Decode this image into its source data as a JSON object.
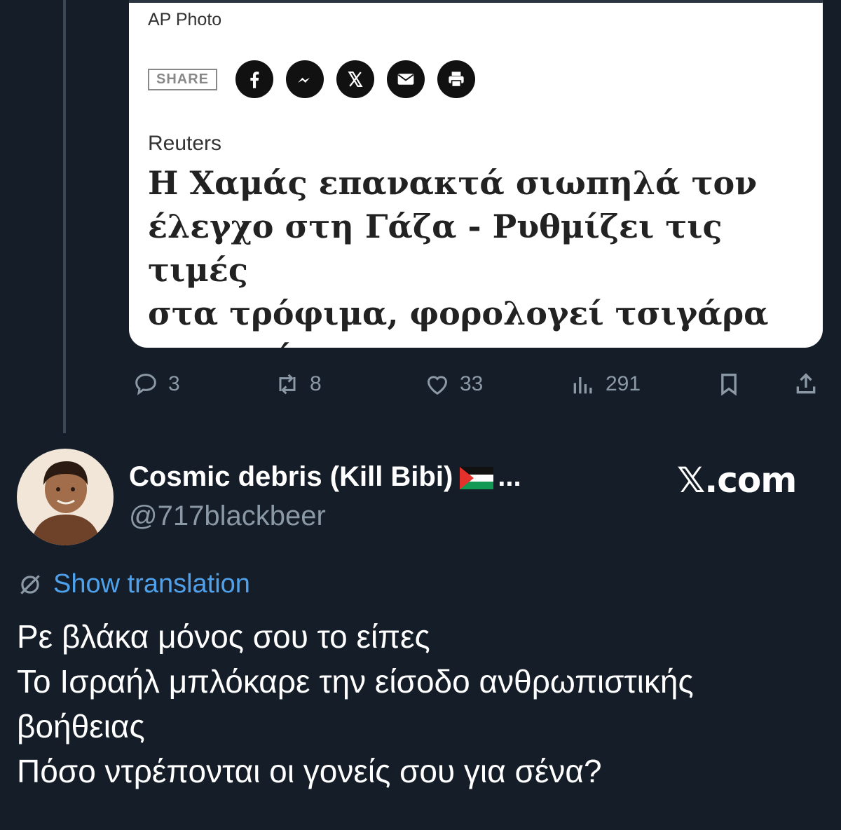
{
  "embed": {
    "photo_credit": "AP Photo",
    "share_label": "SHARE",
    "share_icons": [
      "facebook-icon",
      "messenger-icon",
      "x-icon",
      "email-icon",
      "print-icon"
    ],
    "source": "Reuters",
    "headline_lines": [
      "Η Χαμάς επανακτά σιωπηλά τον",
      "έλεγχο στη Γάζα - Ρυθμίζει τις τιμές",
      "στα τρόφιμα, φορολογεί τσιγάρα",
      "και καύσιμα"
    ]
  },
  "actions": {
    "replies": "3",
    "reposts": "8",
    "likes": "33",
    "views": "291"
  },
  "author": {
    "display_name": "Cosmic debris (Kill Bibi)",
    "ellipsis": "...",
    "handle": "@717blackbeer",
    "site": "𝕏.com"
  },
  "translation": {
    "label": "Show translation"
  },
  "tweet": {
    "lines": [
      "Ρε βλάκα μόνος σου το είπες",
      "Το Ισραήλ μπλόκαρε την είσοδο ανθρωπιστικής",
      "βοήθειας",
      "Πόσο ντρέπονται οι γονείς σου για σένα?"
    ]
  },
  "colors": {
    "background": "#151d28",
    "muted": "#8b98a5",
    "link": "#4ea1ea",
    "card": "#ffffff"
  }
}
